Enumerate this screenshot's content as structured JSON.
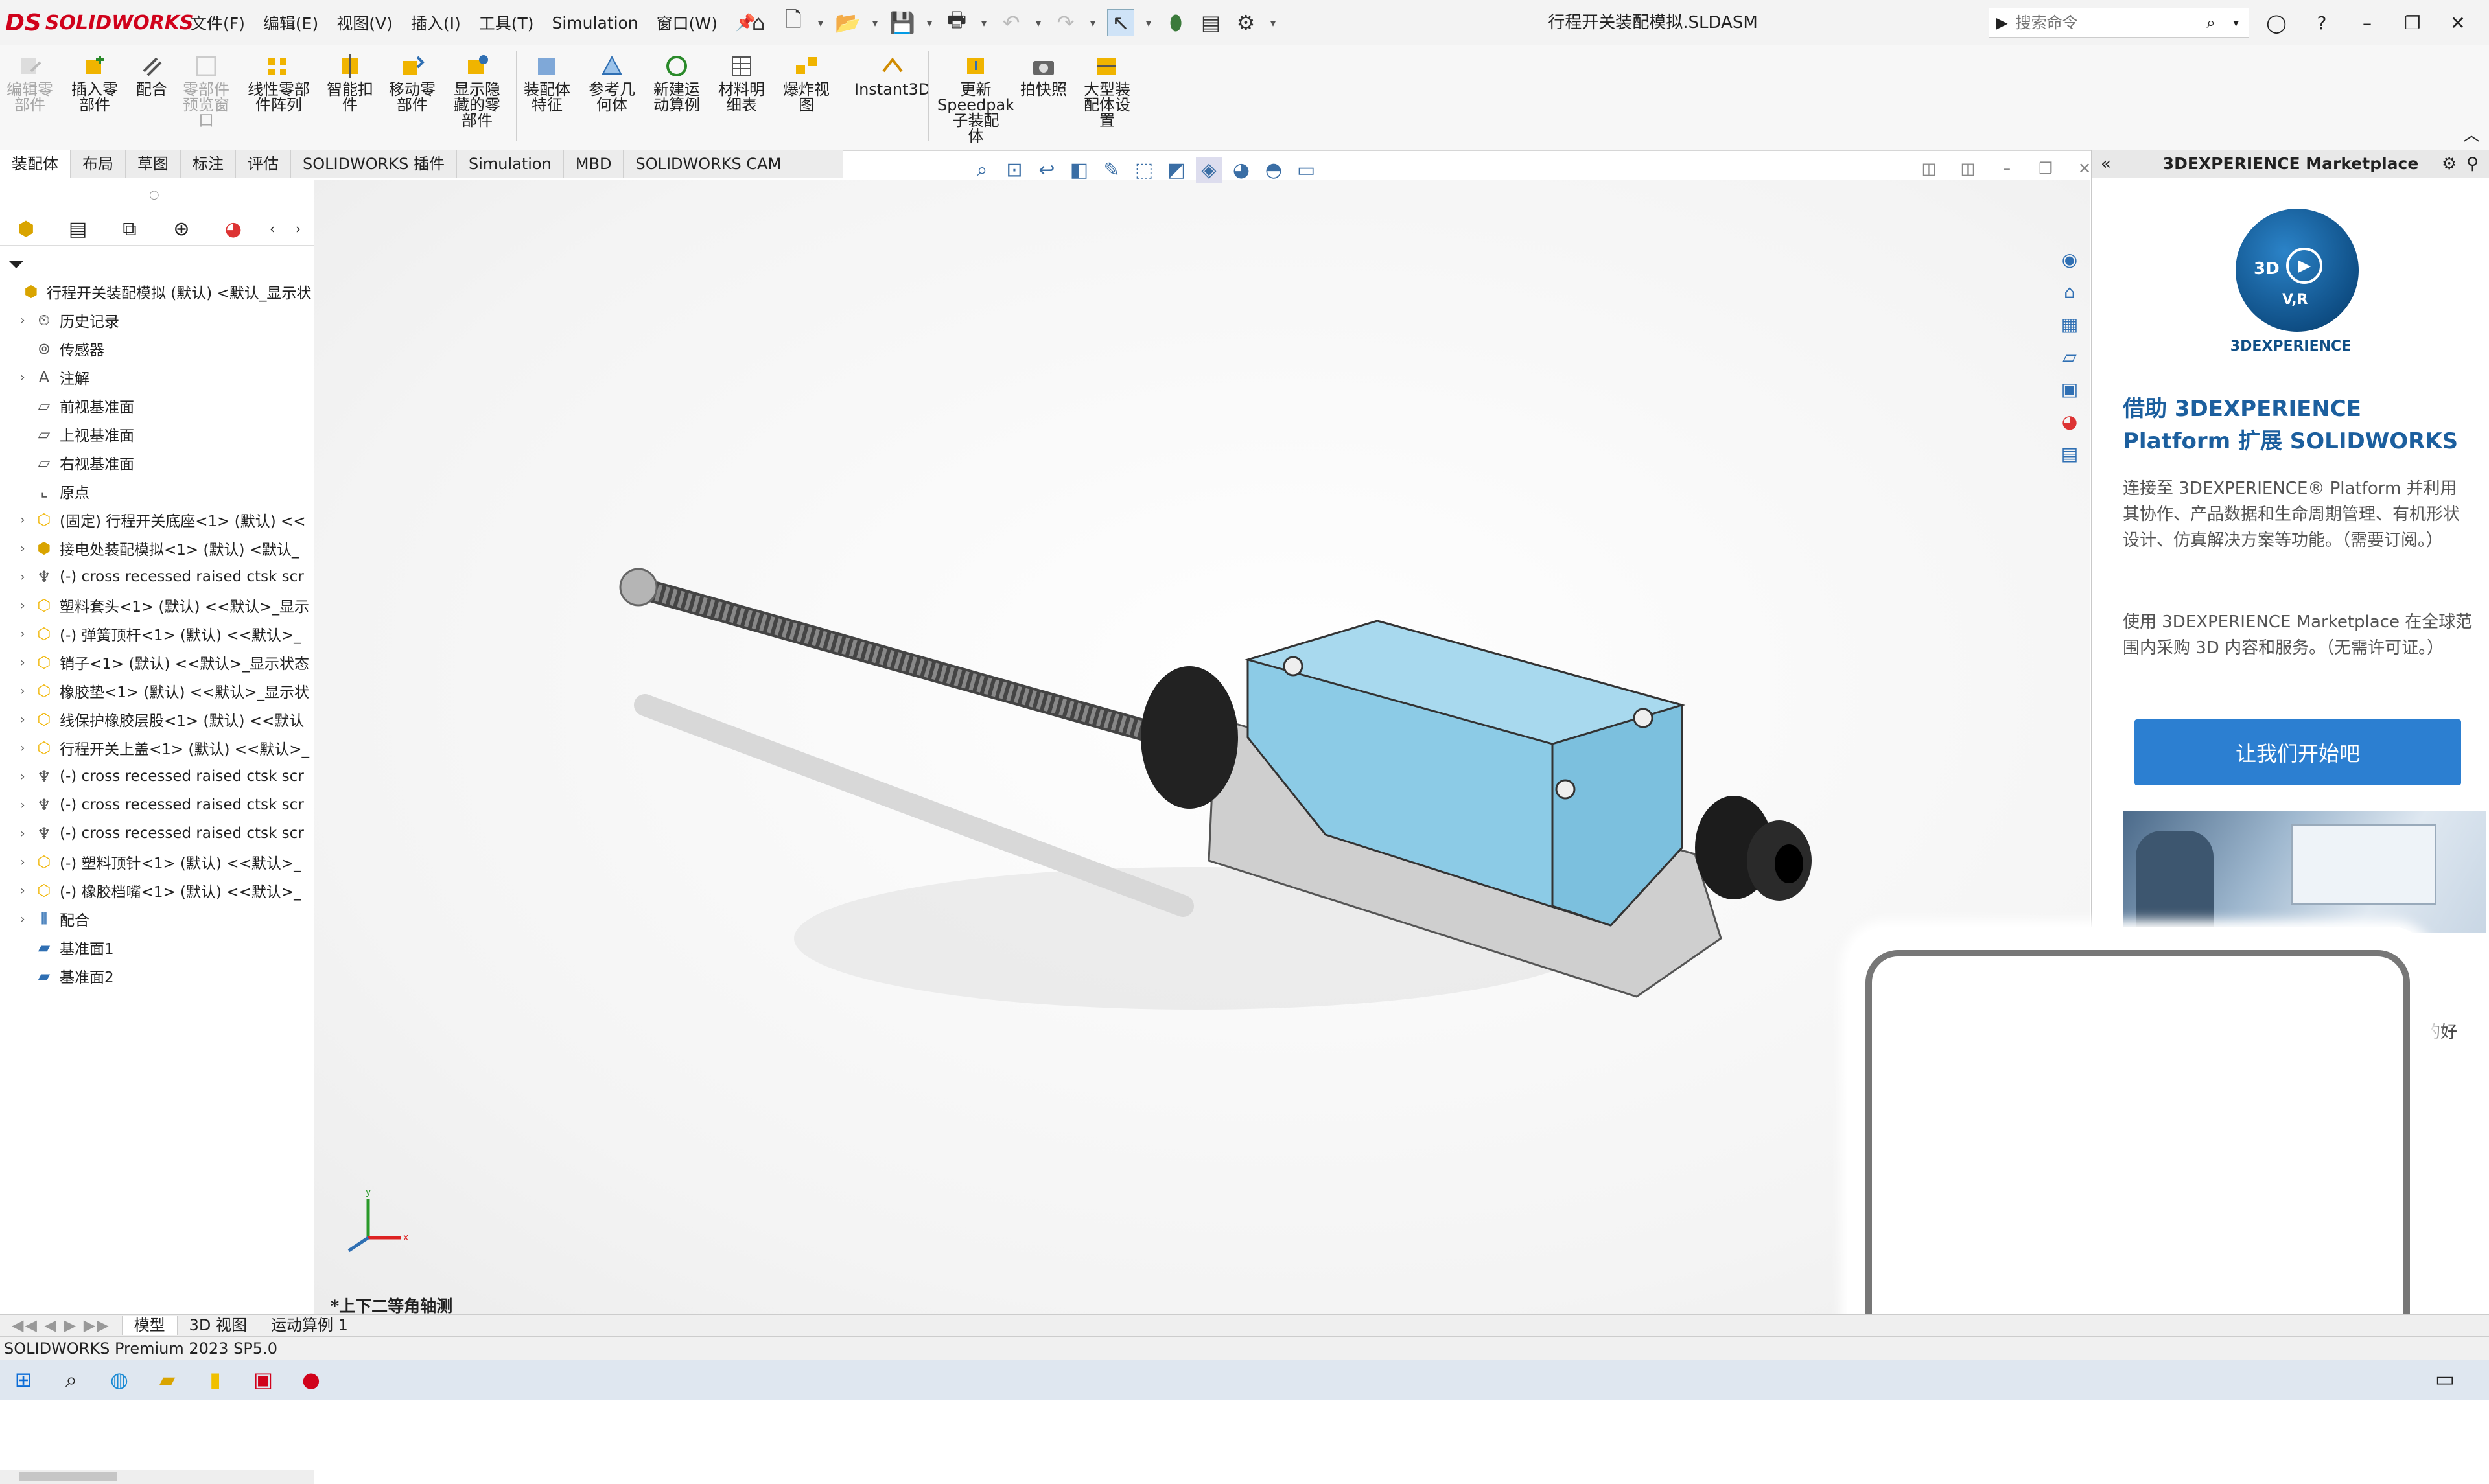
{
  "app": {
    "logo_text": "SOLIDWORKS",
    "logo_mark": "DS",
    "document_title": "行程开关装配模拟.SLDASM",
    "status": "SOLIDWORKS Premium 2023 SP5.0"
  },
  "menu": {
    "items": [
      "文件(F)",
      "编辑(E)",
      "视图(V)",
      "插入(I)",
      "工具(T)",
      "Simulation",
      "窗口(W)"
    ]
  },
  "search": {
    "placeholder": "搜索命令"
  },
  "ribbon": {
    "commands": [
      {
        "label": "编辑零\n部件",
        "disabled": true
      },
      {
        "label": "插入零\n部件",
        "disabled": false
      },
      {
        "label": "配合",
        "disabled": false
      },
      {
        "label": "零部件\n预览窗\n口",
        "disabled": true
      },
      {
        "label": "线性零部\n件阵列",
        "disabled": false
      },
      {
        "label": "智能扣\n件",
        "disabled": false
      },
      {
        "label": "移动零\n部件",
        "disabled": false
      },
      {
        "label": "显示隐\n藏的零\n部件",
        "disabled": false
      },
      {
        "label": "装配体\n特征",
        "disabled": false
      },
      {
        "label": "参考几\n何体",
        "disabled": false
      },
      {
        "label": "新建运\n动算例",
        "disabled": false
      },
      {
        "label": "材料明\n细表",
        "disabled": false
      },
      {
        "label": "爆炸视\n图",
        "disabled": false
      },
      {
        "label": "Instant3D",
        "disabled": false
      },
      {
        "label": "更新\nSpeedpak\n子装配\n体",
        "disabled": false
      },
      {
        "label": "拍快照",
        "disabled": false
      },
      {
        "label": "大型装\n配体设\n置",
        "disabled": false
      }
    ]
  },
  "tabs": [
    "装配体",
    "布局",
    "草图",
    "标注",
    "评估",
    "SOLIDWORKS 插件",
    "Simulation",
    "MBD",
    "SOLIDWORKS CAM"
  ],
  "tree": {
    "nodes": [
      {
        "label": "行程开关装配模拟 (默认) <默认_显示状",
        "icon": "assembly-icon",
        "expand": false,
        "indent": 0
      },
      {
        "label": "历史记录",
        "icon": "history-icon",
        "expand": true,
        "indent": 1
      },
      {
        "label": "传感器",
        "icon": "sensor-icon",
        "expand": false,
        "indent": 1
      },
      {
        "label": "注解",
        "icon": "annotation-icon",
        "expand": true,
        "indent": 1
      },
      {
        "label": "前视基准面",
        "icon": "plane-icon",
        "expand": false,
        "indent": 1
      },
      {
        "label": "上视基准面",
        "icon": "plane-icon",
        "expand": false,
        "indent": 1
      },
      {
        "label": "右视基准面",
        "icon": "plane-icon",
        "expand": false,
        "indent": 1
      },
      {
        "label": "原点",
        "icon": "origin-icon",
        "expand": false,
        "indent": 1
      },
      {
        "label": "(固定) 行程开关底座<1> (默认) <<",
        "icon": "part-icon",
        "expand": true,
        "indent": 1
      },
      {
        "label": "接电处装配模拟<1> (默认) <默认_",
        "icon": "assembly-icon",
        "expand": true,
        "indent": 1
      },
      {
        "label": "(-) cross recessed raised ctsk scr",
        "icon": "screw-icon",
        "expand": true,
        "indent": 1
      },
      {
        "label": "塑料套头<1> (默认) <<默认>_显示",
        "icon": "part-icon",
        "expand": true,
        "indent": 1
      },
      {
        "label": "(-) 弹簧顶杆<1> (默认) <<默认>_",
        "icon": "part-icon",
        "expand": true,
        "indent": 1
      },
      {
        "label": "销子<1> (默认) <<默认>_显示状态",
        "icon": "part-icon",
        "expand": true,
        "indent": 1
      },
      {
        "label": "橡胶垫<1> (默认) <<默认>_显示状",
        "icon": "part-icon",
        "expand": true,
        "indent": 1
      },
      {
        "label": "线保护橡胶层股<1> (默认) <<默认",
        "icon": "part-icon",
        "expand": true,
        "indent": 1
      },
      {
        "label": "行程开关上盖<1> (默认) <<默认>_",
        "icon": "part-icon",
        "expand": true,
        "indent": 1
      },
      {
        "label": "(-) cross recessed raised ctsk scr",
        "icon": "screw-icon",
        "expand": true,
        "indent": 1
      },
      {
        "label": "(-) cross recessed raised ctsk scr",
        "icon": "screw-icon",
        "expand": true,
        "indent": 1
      },
      {
        "label": "(-) cross recessed raised ctsk scr",
        "icon": "screw-icon",
        "expand": true,
        "indent": 1
      },
      {
        "label": "(-) 塑料顶针<1> (默认) <<默认>_",
        "icon": "part-icon",
        "expand": true,
        "indent": 1
      },
      {
        "label": "(-) 橡胶档嘴<1> (默认) <<默认>_",
        "icon": "part-icon",
        "expand": true,
        "indent": 1
      },
      {
        "label": "配合",
        "icon": "mates-icon",
        "expand": true,
        "indent": 1
      },
      {
        "label": "基准面1",
        "icon": "plane-blue-icon",
        "expand": false,
        "indent": 1
      },
      {
        "label": "基准面2",
        "icon": "plane-blue-icon",
        "expand": false,
        "indent": 1
      }
    ]
  },
  "bottom_tabs": [
    "模型",
    "3D 视图",
    "运动算例 1"
  ],
  "view_label": "*上下二等角轴测",
  "triad": {
    "x": "x",
    "y": "y"
  },
  "taskpane": {
    "title": "3DEXPERIENCE Marketplace",
    "logo_text": "3DEXPERIENCE",
    "logo_badge": "3D",
    "logo_vr": "V,R",
    "heading": "借助 3DEXPERIENCE Platform 扩展 SOLIDWORKS",
    "paragraph1": "连接至 3DEXPERIENCE® Platform 并利用其协作、产品数据和生命周期管理、有机形状设计、仿真解决方案等功能。（需要订阅。）",
    "paragraph2": "使用 3DEXPERIENCE Marketplace 在全球范围内采购 3D 内容和服务。（无需许可证。）",
    "button": "让我们开始吧",
    "side_text": "的好"
  },
  "colors": {
    "accent_blue": "#2c7fd1",
    "model_cover": "#8ccbe6",
    "brand_red": "#d0021b"
  }
}
